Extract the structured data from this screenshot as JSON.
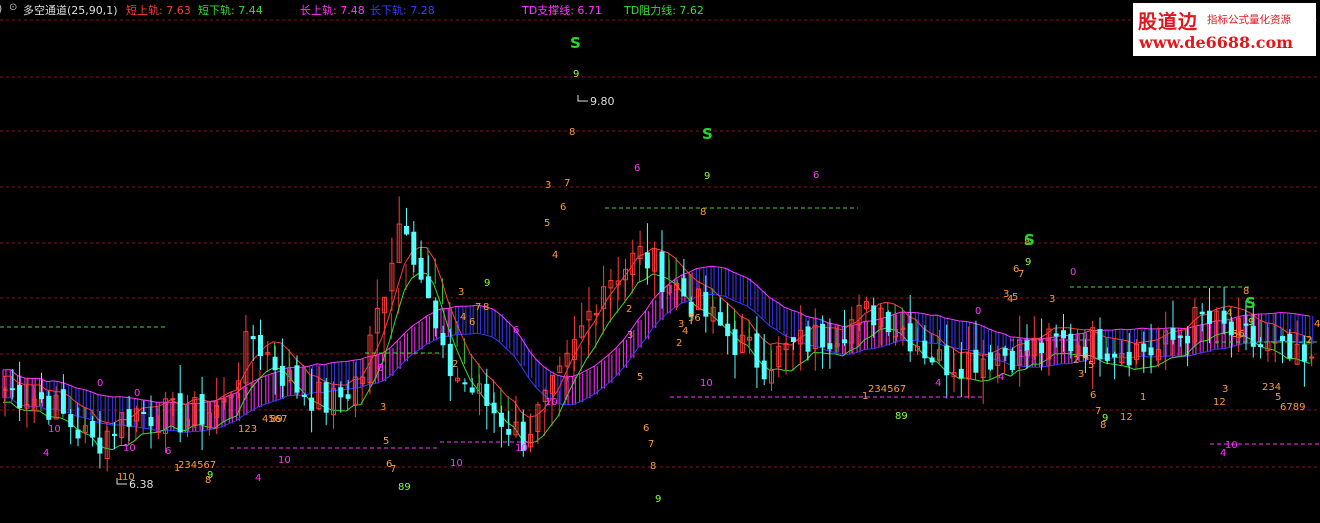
{
  "header": {
    "indicator_name": "多空通道(25,90,1)",
    "items": [
      {
        "label": "短上轨",
        "value": "7.63",
        "color": "#ff3b3b"
      },
      {
        "label": "短下轨",
        "value": "7.44",
        "color": "#33dd33"
      },
      {
        "label": "长上轨",
        "value": "7.48",
        "color": "#ff33ff"
      },
      {
        "label": "长下轨",
        "value": "7.28",
        "color": "#3a3aff"
      },
      {
        "label": "TD支撑线",
        "value": "6.71",
        "color": "#ff33ff"
      },
      {
        "label": "TD阻力线",
        "value": "7.62",
        "color": "#33dd33"
      }
    ]
  },
  "logo": {
    "name": "股道边",
    "tagline": "指标公式量化资源",
    "url": "www.de6688.com"
  },
  "chart_data": {
    "type": "candlestick",
    "price_annotations": [
      {
        "label": "9.80",
        "x_index": 100
      },
      {
        "label": "6.38",
        "x_index": 22
      }
    ],
    "td_sequence_labels": [
      "1",
      "2",
      "3",
      "4",
      "5",
      "6",
      "7",
      "8",
      "9",
      "10",
      "12",
      "S",
      "0"
    ],
    "colors": {
      "up_candle": "#ff3b3b",
      "down_candle": "#54ffff",
      "short_upper": "#ff3b3b",
      "short_lower": "#33dd33",
      "long_upper": "#ff33ff",
      "long_lower": "#3a3aff",
      "grid": "#8a1010",
      "td_support": "#ff33ff",
      "td_resistance": "#33dd33",
      "setup_orange": "#ff9933",
      "count_magenta": "#ff33ff",
      "count_green": "#88ff44"
    }
  }
}
